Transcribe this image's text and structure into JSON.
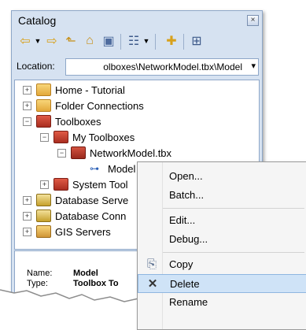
{
  "window": {
    "title": "Catalog",
    "close_glyph": "×"
  },
  "toolbar": {
    "icons": [
      "back-arrow-icon",
      "dropdown-arrow-icon",
      "forward-arrow-icon",
      "up-folder-icon",
      "home-folder-icon",
      "connect-folder-icon",
      "view-icon",
      "dropdown-arrow-icon",
      "new-folder-icon",
      "tree-icon"
    ]
  },
  "location": {
    "label": "Location:",
    "value": "olboxes\\NetworkModel.tbx\\Model",
    "arrow": "▾"
  },
  "tree": {
    "items": [
      {
        "label": "Home - Tutorial",
        "expander": "+"
      },
      {
        "label": "Folder Connections",
        "expander": "+"
      },
      {
        "label": "Toolboxes",
        "expander": "−"
      },
      {
        "label": "My Toolboxes",
        "expander": "−"
      },
      {
        "label": "NetworkModel.tbx",
        "expander": "−"
      },
      {
        "label": "Model"
      },
      {
        "label": "System Tool",
        "expander": "+"
      },
      {
        "label": "Database Serve",
        "expander": "+"
      },
      {
        "label": "Database Conn",
        "expander": "+"
      },
      {
        "label": "GIS Servers",
        "expander": "+"
      }
    ]
  },
  "details": {
    "name_label": "Name:",
    "name_value": "Model",
    "type_label": "Type:",
    "type_value": "Toolbox To"
  },
  "context_menu": {
    "items": [
      {
        "label": "Open..."
      },
      {
        "label": "Batch..."
      },
      {
        "label": "Edit..."
      },
      {
        "label": "Debug..."
      },
      {
        "label": "Copy",
        "icon": "copy-icon"
      },
      {
        "label": "Delete",
        "icon": "delete-x-icon",
        "glyph": "✕",
        "highlighted": true
      },
      {
        "label": "Rename"
      }
    ]
  },
  "colors": {
    "window_bg": "#d6e2f1",
    "highlight": "#cfe3f7"
  }
}
